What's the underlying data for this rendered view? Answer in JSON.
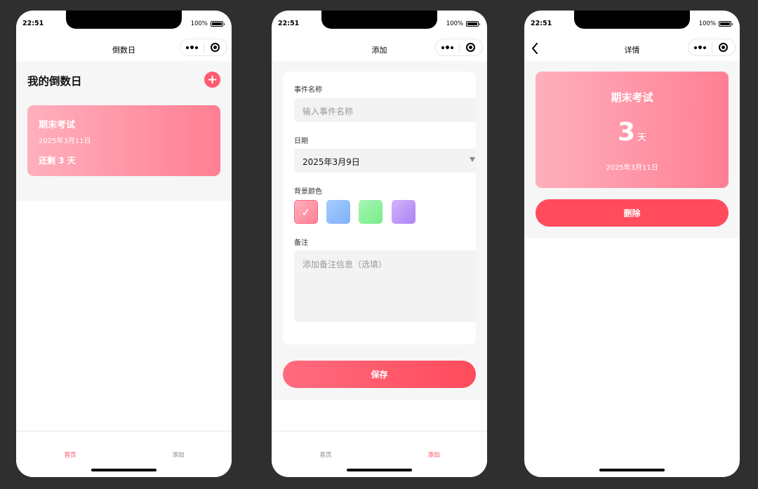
{
  "status_bar": {
    "time": "22:51",
    "battery": "100%"
  },
  "home": {
    "nav_title": "倒数日",
    "heading": "我的倒数日",
    "add_symbol": "+",
    "events": [
      {
        "name": "期末考试",
        "date": "2025年3月11日",
        "remaining": "还剩 3 天",
        "color": "#ff8fa3"
      }
    ],
    "tabs": [
      {
        "label": "首页",
        "active": true
      },
      {
        "label": "添加",
        "active": false
      }
    ]
  },
  "add": {
    "nav_title": "添加",
    "name_label": "事件名称",
    "name_placeholder": "输入事件名称",
    "date_label": "日期",
    "date_value": "2025年3月9日",
    "color_label": "背景颜色",
    "check_mark": "✓",
    "colors": [
      {
        "id": "pink",
        "from": "#ffafbd",
        "to": "#ff8197",
        "selected": true
      },
      {
        "id": "blue",
        "from": "#a5cdfb",
        "to": "#7fb1fa",
        "selected": false
      },
      {
        "id": "green",
        "from": "#a8f5b4",
        "to": "#77ec8a",
        "selected": false
      },
      {
        "id": "purple",
        "from": "#d4b3fb",
        "to": "#ac82f3",
        "selected": false
      }
    ],
    "note_label": "备注",
    "note_placeholder": "添加备注信息（选填）",
    "save_label": "保存",
    "tabs": [
      {
        "label": "首页",
        "active": false
      },
      {
        "label": "添加",
        "active": true
      }
    ]
  },
  "detail": {
    "nav_title": "详情",
    "name": "期末考试",
    "days": "3",
    "unit": "天",
    "date": "2025年3月11日",
    "delete_label": "删除"
  }
}
